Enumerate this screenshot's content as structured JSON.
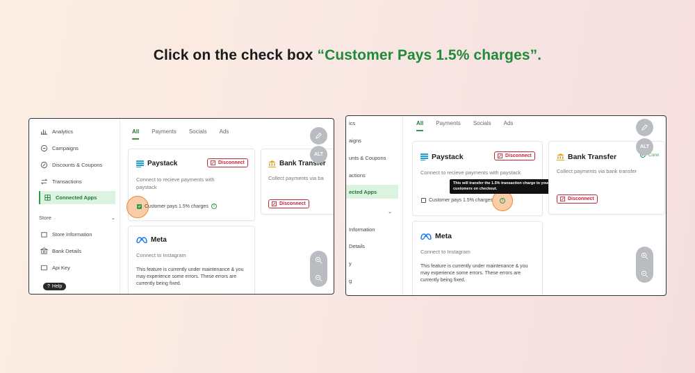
{
  "headline": {
    "prefix": "Click on the check box ",
    "highlight": "“Customer Pays 1.5% charges”."
  },
  "left": {
    "sidebar": {
      "items": [
        {
          "label": "Analytics",
          "icon": "analytics-icon"
        },
        {
          "label": "Campaigns",
          "icon": "campaigns-icon"
        },
        {
          "label": "Discounts & Coupons",
          "icon": "discount-icon"
        },
        {
          "label": "Transactions",
          "icon": "transactions-icon"
        },
        {
          "label": "Connected Apps",
          "icon": "apps-icon",
          "active": true
        }
      ],
      "section": "Store",
      "store_items": [
        {
          "label": "Store Information",
          "icon": "store-icon"
        },
        {
          "label": "Bank Details",
          "icon": "bank-icon"
        },
        {
          "label": "Api Key",
          "icon": "key-icon"
        },
        {
          "label": "...",
          "icon": "misc-icon"
        }
      ],
      "help": "Help"
    },
    "tabs": [
      "All",
      "Payments",
      "Socials",
      "Ads"
    ],
    "paystack": {
      "title": "Paystack",
      "desc": "Connect to recieve payments with paystack",
      "disconnect": "Disconnect",
      "checkbox_label": "Customer pays 1.5% charges",
      "checked": true
    },
    "bank": {
      "title": "Bank Transfer",
      "desc": "Collect payments via ba",
      "disconnect": "Disconnect"
    },
    "meta": {
      "title": "Meta",
      "desc": "Connect to Instagram",
      "note": "This feature is currently under maintenance & you may experience some errors. These errors are currently being fixed."
    },
    "fab_alt": "ALT"
  },
  "right": {
    "sidebar": {
      "items": [
        "ics",
        "aigns",
        "unts & Coupons",
        "actions",
        "ected Apps"
      ],
      "store_items": [
        "Information",
        "Details",
        "y",
        "g"
      ]
    },
    "tabs": [
      "All",
      "Payments",
      "Socials",
      "Ads"
    ],
    "paystack": {
      "title": "Paystack",
      "desc": "Connect to recieve payments with paystack",
      "disconnect": "Disconnect",
      "checkbox_label": "Customer pays 1.5% charges",
      "checked": false,
      "tooltip": "This will transfer the 1.5% transaction charge to your customers on checkout."
    },
    "bank": {
      "title": "Bank Transfer",
      "desc": "Collect payments via bank transfer",
      "disconnect": "Disconnect",
      "badge": "Conn"
    },
    "meta": {
      "title": "Meta",
      "desc": "Connect to Instagram",
      "note": "This feature is currently under maintenance & you may experience some errors. These errors are currently being fixed."
    },
    "fab_alt": "ALT"
  },
  "colors": {
    "accent": "#2f9a4a",
    "danger": "#c0263a",
    "highlight": "#f08a3a"
  }
}
